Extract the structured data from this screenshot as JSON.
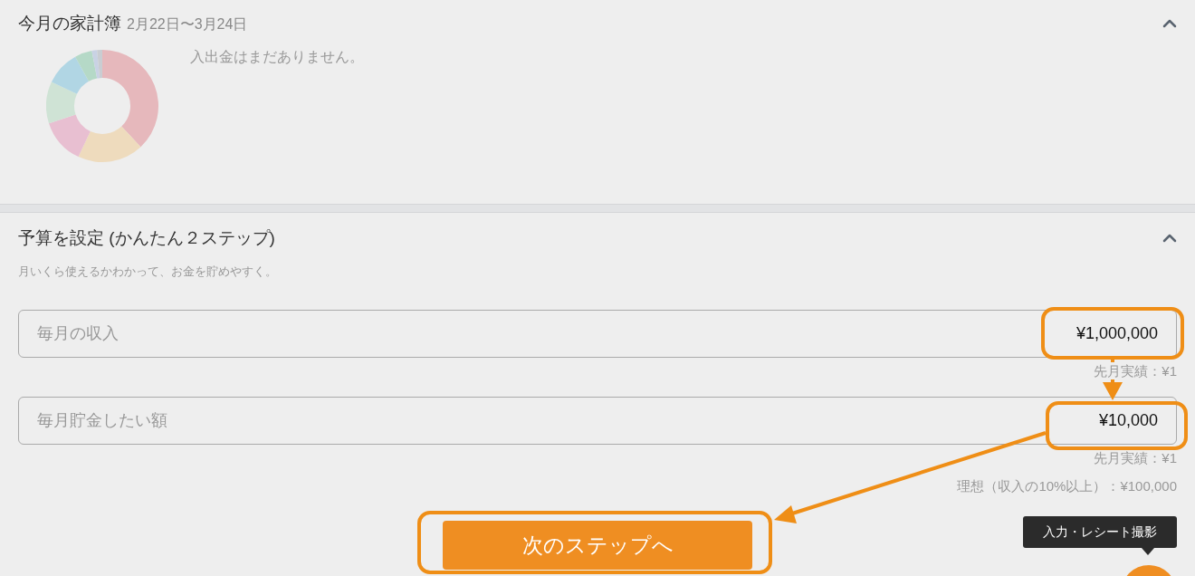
{
  "summary": {
    "title": "今月の家計簿",
    "date_range": "2月22日〜3月24日",
    "expanded": true,
    "empty_message": "入出金はまだありません。"
  },
  "budget": {
    "title": "予算を設定 (かんたん２ステップ)",
    "expanded": true,
    "subtitle": "月いくら使えるかわかって、お金を貯めやすく。",
    "fields": [
      {
        "label": "毎月の収入",
        "value": "¥1,000,000",
        "notes": [
          "先月実績：¥1"
        ]
      },
      {
        "label": "毎月貯金したい額",
        "value": "¥10,000",
        "notes": [
          "先月実績：¥1",
          "理想（収入の10%以上）：¥100,000"
        ]
      }
    ],
    "next_button": "次のステップへ"
  },
  "tooltip": "入力・レシート撮影"
}
